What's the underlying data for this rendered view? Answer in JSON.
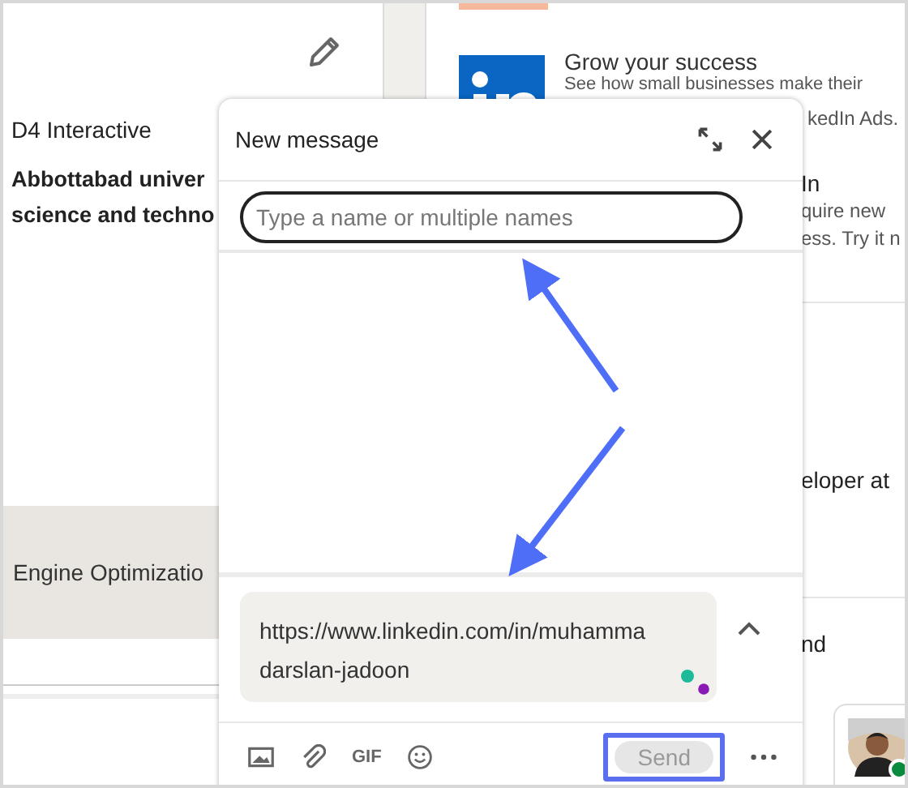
{
  "profile": {
    "company": "D4 Interactive",
    "school_lines": [
      "Abbottabad univer",
      "science and techno"
    ],
    "skill": "Engine Optimizatio"
  },
  "ad": {
    "title": "Grow your success",
    "lines": [
      "See how small businesses make their",
      "kedIn Ads."
    ],
    "second_title": "In",
    "second_lines": [
      "quire new",
      "ess. Try it n"
    ]
  },
  "feed": {
    "snippets": [
      "eloper at",
      "nd"
    ]
  },
  "compose": {
    "title": "New message",
    "recipient": {
      "placeholder": "Type a name or multiple names"
    },
    "message_lines": [
      "https://www.linkedin.com/in/muhamma",
      "darslan-jadoon"
    ],
    "gif": "GIF",
    "send": {
      "label": "Send",
      "disabled": true
    }
  }
}
